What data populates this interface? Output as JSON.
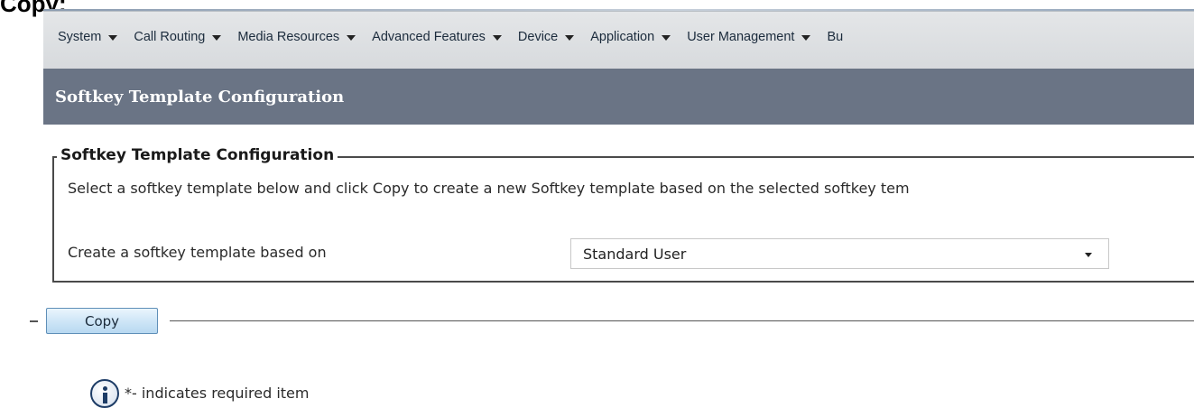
{
  "caption": "Copy:",
  "menu": {
    "items": [
      {
        "label": "System",
        "name": "menu-system"
      },
      {
        "label": "Call Routing",
        "name": "menu-call-routing"
      },
      {
        "label": "Media Resources",
        "name": "menu-media-resources"
      },
      {
        "label": "Advanced Features",
        "name": "menu-advanced-features"
      },
      {
        "label": "Device",
        "name": "menu-device"
      },
      {
        "label": "Application",
        "name": "menu-application"
      },
      {
        "label": "User Management",
        "name": "menu-user-management"
      },
      {
        "label": "Bu",
        "name": "menu-bulk-administration"
      }
    ]
  },
  "page": {
    "title": "Softkey Template Configuration"
  },
  "section": {
    "legend": "Softkey Template Configuration",
    "description": "Select a softkey template below and click Copy to create a new Softkey template based on the selected softkey tem",
    "field_label": "Create a softkey template based on",
    "select_value": "Standard User"
  },
  "actions": {
    "copy_label": "Copy"
  },
  "footer": {
    "required_note": "*- indicates required item"
  },
  "icons": {
    "menu_dropdown": "chevron-down-icon",
    "select_dropdown": "chevron-down-icon",
    "info": "info-icon"
  },
  "colors": {
    "title_bar": "#6a7485",
    "menu_bar": "#d7dadd",
    "copy_button": "#cfe6f7",
    "info_icon": "#1d3c66"
  }
}
